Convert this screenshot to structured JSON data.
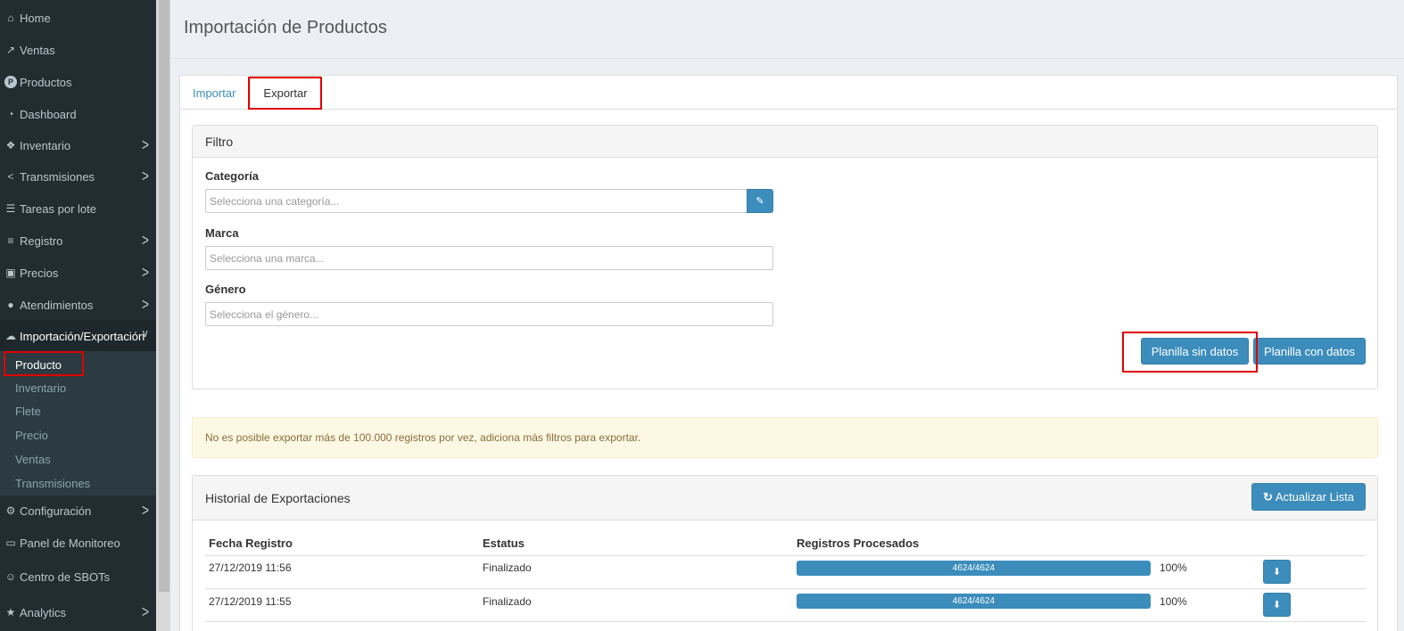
{
  "sidebar": {
    "items": [
      {
        "label": "Home",
        "icon": "home-icon",
        "glyph": "⌂",
        "chevron": false
      },
      {
        "label": "Ventas",
        "icon": "line-chart-icon",
        "glyph": "↗",
        "chevron": false
      },
      {
        "label": "Productos",
        "icon": "product-circle-icon",
        "glyph": "P",
        "chevron": false
      },
      {
        "label": "Dashboard",
        "icon": "dashboard-icon",
        "glyph": "◔",
        "chevron": false
      },
      {
        "label": "Inventario",
        "icon": "cubes-icon",
        "glyph": "❖",
        "chevron": true
      },
      {
        "label": "Transmisiones",
        "icon": "share-icon",
        "glyph": "<",
        "chevron": true
      },
      {
        "label": "Tareas por lote",
        "icon": "tasks-icon",
        "glyph": "☰",
        "chevron": false
      },
      {
        "label": "Registro",
        "icon": "list-icon",
        "glyph": "≡",
        "chevron": true
      },
      {
        "label": "Precios",
        "icon": "money-icon",
        "glyph": "▣",
        "chevron": true
      },
      {
        "label": "Atendimientos",
        "icon": "comments-icon",
        "glyph": "●",
        "chevron": true
      },
      {
        "label": "Importación/Exportación",
        "icon": "cloud-icon",
        "glyph": "☁",
        "chevron": true
      },
      {
        "label": "Configuración",
        "icon": "gear-icon",
        "glyph": "⚙",
        "chevron": true
      },
      {
        "label": "Panel de Monitoreo",
        "icon": "monitor-icon",
        "glyph": "▭",
        "chevron": false
      },
      {
        "label": "Centro de SBOTs",
        "icon": "robot-icon",
        "glyph": "☺",
        "chevron": false
      },
      {
        "label": "Analytics",
        "icon": "star-icon",
        "glyph": "★",
        "chevron": true
      }
    ],
    "submenu": [
      "Producto",
      "Inventario",
      "Flete",
      "Precio",
      "Ventas",
      "Transmisiones"
    ],
    "chevron_right": ">",
    "chevron_down": "∨"
  },
  "page": {
    "title": "Importación de Productos"
  },
  "tabs": {
    "import": "Importar",
    "export": "Exportar"
  },
  "filter": {
    "title": "Filtro",
    "category_label": "Categoría",
    "category_placeholder": "Selecciona una categoría...",
    "brand_label": "Marca",
    "brand_placeholder": "Selecciona una marca...",
    "gender_label": "Género",
    "gender_placeholder": "Selecciona el género...",
    "edit_glyph": "✎",
    "btn_without_data": "Planilla sin datos",
    "btn_with_data": "Planilla con datos"
  },
  "alert": {
    "text": "No es posible exportar más de 100.000 registros por vez, adiciona más filtros para exportar."
  },
  "history": {
    "title": "Historial de Exportaciones",
    "refresh_label": "Actualizar Lista",
    "refresh_glyph": "↻",
    "download_glyph": "⬇",
    "columns": [
      "Fecha Registro",
      "Estatus",
      "Registros Procesados"
    ],
    "rows": [
      {
        "date": "27/12/2019 11:56",
        "status": "Finalizado",
        "progress_text": "4624/4624",
        "progress": 1.0,
        "percent": "100%"
      },
      {
        "date": "27/12/2019 11:55",
        "status": "Finalizado",
        "progress_text": "4624/4624",
        "progress": 1.0,
        "percent": "100%"
      }
    ]
  },
  "colors": {
    "primary": "#3c8dbc",
    "sidebar_bg": "#222d32",
    "highlight": "#e00000"
  }
}
